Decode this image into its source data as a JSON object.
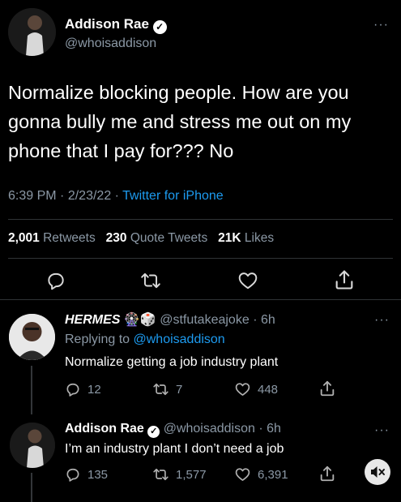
{
  "main_tweet": {
    "author_name": "Addison Rae",
    "author_handle": "@whoisaddison",
    "text": "Normalize blocking people. How are you gonna bully me and stress me out on my phone that I pay for??? No",
    "time": "6:39 PM",
    "sep1": "·",
    "date": "2/23/22",
    "sep2": "·",
    "source": "Twitter for iPhone",
    "retweets_count": "2,001",
    "retweets_label": "Retweets",
    "quotes_count": "230",
    "quotes_label": "Quote Tweets",
    "likes_count": "21K",
    "likes_label": "Likes",
    "more": "···"
  },
  "reply1": {
    "author_name": "HERMES",
    "emoji1": "🎡",
    "emoji2": "🎲",
    "author_handle": "@stfutakeajoke",
    "sep": "·",
    "time": "6h",
    "replying_prefix": "Replying to",
    "replying_to": "@whoisaddison",
    "text": "Normalize getting a job industry plant",
    "replies": "12",
    "retweets": "7",
    "likes": "448",
    "more": "···"
  },
  "reply2": {
    "author_name": "Addison Rae",
    "author_handle": "@whoisaddison",
    "sep": "·",
    "time": "6h",
    "text": "I’m an industry plant I don’t need a job",
    "replies": "135",
    "retweets": "1,577",
    "likes": "6,391",
    "more": "···"
  },
  "colors": {
    "background": "#000000",
    "link": "#1d9bf0",
    "secondary_text": "#8b98a5",
    "divider": "#2f3336"
  }
}
